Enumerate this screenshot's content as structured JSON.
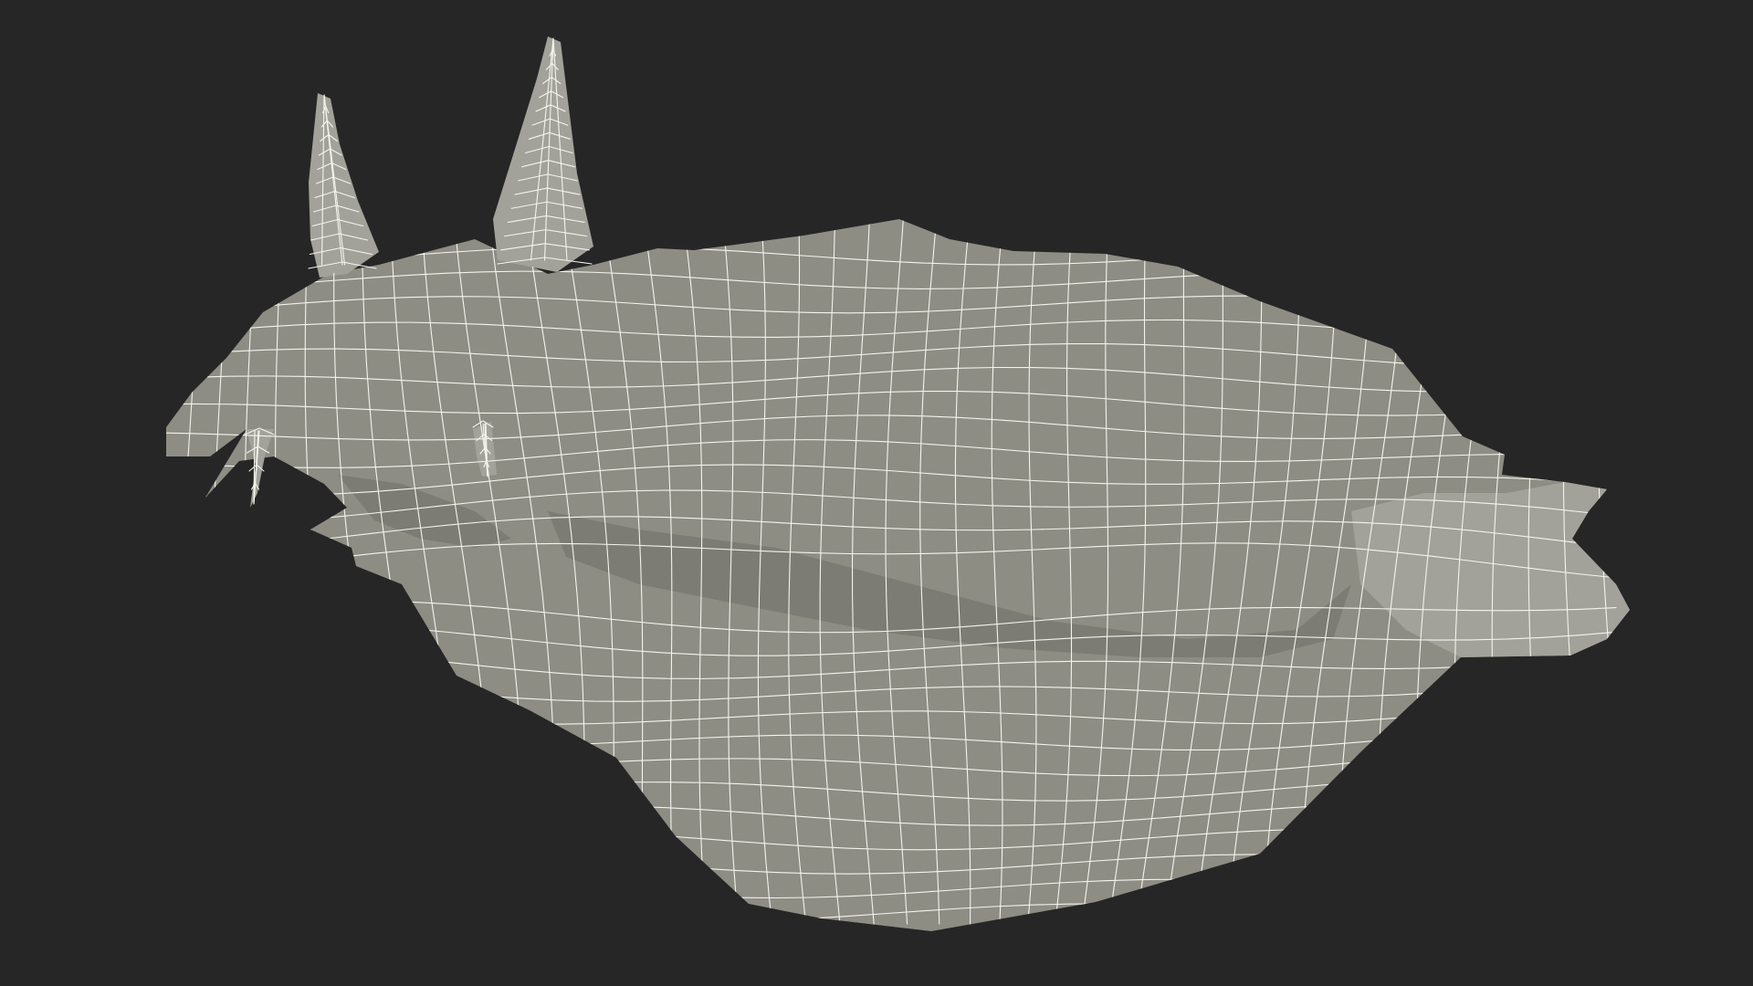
{
  "viewport": {
    "background_color": "#262626"
  },
  "model": {
    "render_mode": "wireframe-on-shaded",
    "surface_color": "#8d8d84",
    "shadow_color": "#6f6f68",
    "highlight_color": "#a2a29a",
    "wire_color": "#f4f4ef"
  }
}
